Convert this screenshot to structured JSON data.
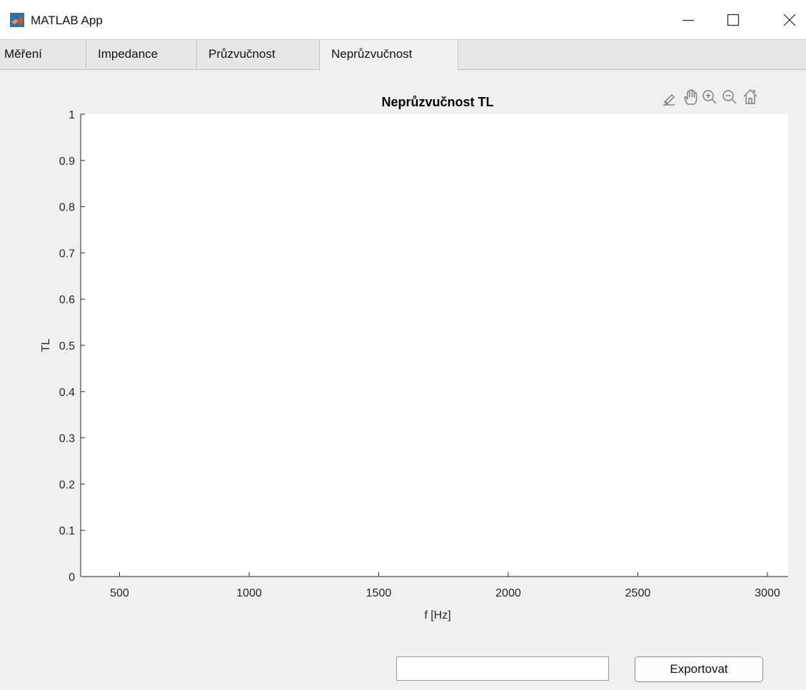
{
  "window": {
    "title": "MATLAB App"
  },
  "tabs": [
    {
      "label": "Měření"
    },
    {
      "label": "Impedance"
    },
    {
      "label": "Průzvučnost"
    },
    {
      "label": "Neprůzvučnost",
      "active": true
    }
  ],
  "axes_toolbar": [
    "brush-icon",
    "pan-hand-icon",
    "zoom-in-icon",
    "zoom-out-icon",
    "home-restore-icon"
  ],
  "chart_data": {
    "type": "line",
    "title": "Neprůzvučnost TL",
    "xlabel": "f [Hz]",
    "ylabel": "TL",
    "xlim": [
      350,
      3080
    ],
    "ylim": [
      0,
      1
    ],
    "x_ticks": [
      500,
      1000,
      1500,
      2000,
      2500,
      3000
    ],
    "y_ticks": [
      0,
      0.1,
      0.2,
      0.3,
      0.4,
      0.5,
      0.6,
      0.7,
      0.8,
      0.9,
      1
    ],
    "series": [],
    "grid": false
  },
  "export": {
    "value": "",
    "button_label": "Exportovat"
  },
  "colors": {
    "matlab_icon_orange": "#d9531e",
    "matlab_icon_blue": "#0072bd",
    "axis": "#262626",
    "background": "#f0f0f0"
  }
}
